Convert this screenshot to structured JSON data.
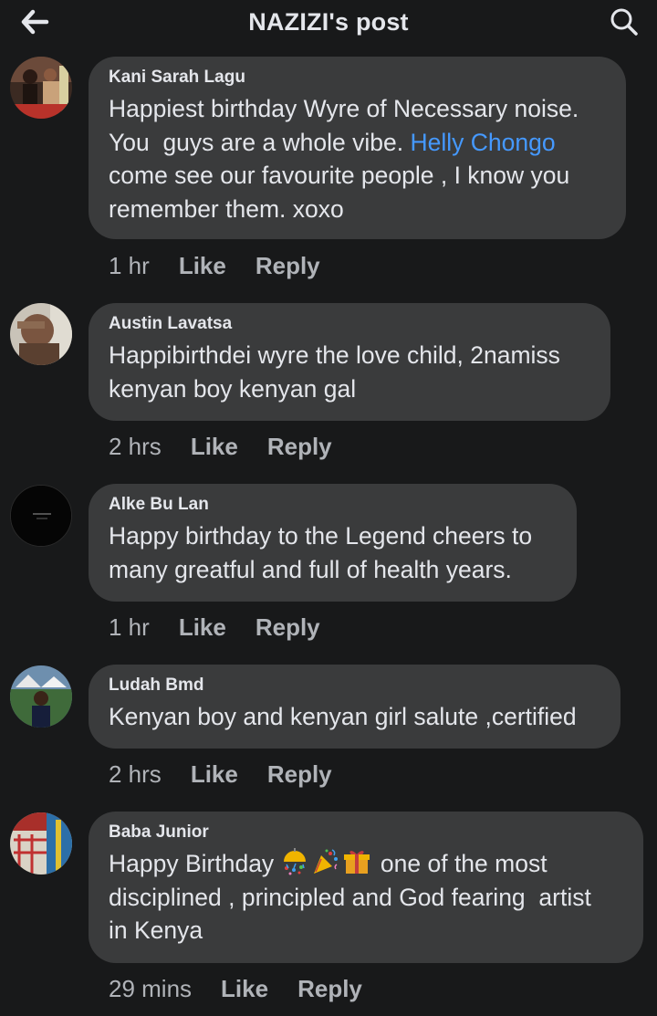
{
  "header": {
    "title": "NAZIZI's post"
  },
  "comments": [
    {
      "author": "Kani Sarah Lagu",
      "text_before": "Happiest birthday Wyre of Necessary noise.\nYou  guys are a whole vibe. ",
      "mention": "Helly Chongo",
      "text_after": "\ncome see our favourite people , I know you\nremember them. xoxo",
      "time": "1 hr",
      "like": "Like",
      "reply": "Reply"
    },
    {
      "author": "Austin Lavatsa",
      "text": "Happibirthdei wyre the love child, 2namiss\nkenyan boy kenyan gal",
      "time": "2 hrs",
      "like": "Like",
      "reply": "Reply"
    },
    {
      "author": "Alke Bu Lan",
      "text": "Happy birthday to the Legend cheers to\nmany greatful and full of health years.",
      "time": "1 hr",
      "like": "Like",
      "reply": "Reply"
    },
    {
      "author": "Ludah Bmd",
      "text": "Kenyan boy and kenyan girl salute ,certified",
      "time": "2 hrs",
      "like": "Like",
      "reply": "Reply"
    },
    {
      "author": "Baba Junior",
      "text_before": "Happy Birthday ",
      "emojis": [
        "confetti-ball-icon",
        "party-popper-icon",
        "gift-icon"
      ],
      "text_after": " one of the most\ndisciplined , principled and God fearing  artist\nin Kenya",
      "time": "29 mins",
      "like": "Like",
      "reply": "Reply"
    }
  ],
  "colors": {
    "background": "#18191a",
    "bubble": "#3a3b3c",
    "text": "#e4e6eb",
    "muted": "#b0b3b8",
    "mention": "#4599ff"
  }
}
